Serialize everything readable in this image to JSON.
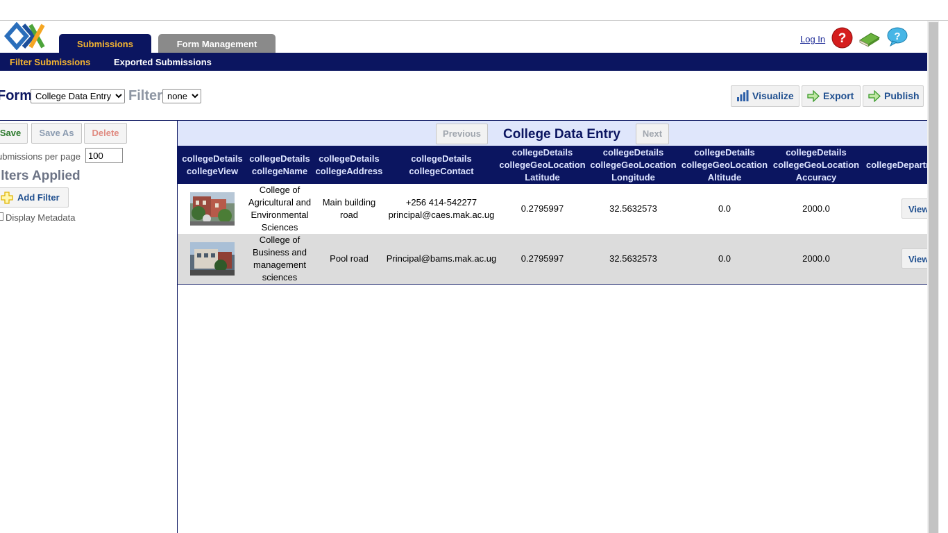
{
  "header": {
    "logo": "odk-logo",
    "tabs": [
      {
        "label": "Submissions",
        "active": true
      },
      {
        "label": "Form Management",
        "active": false
      }
    ],
    "login_label": "Log In",
    "icons": [
      "help-icon",
      "book-icon",
      "chat-help-icon"
    ]
  },
  "subnav": {
    "items": [
      "Filter Submissions",
      "Exported Submissions"
    ]
  },
  "formbar": {
    "form_label": "Form",
    "form_selected": "College Data Entry",
    "filter_label": "Filter",
    "filter_selected": "none",
    "actions": [
      "Visualize",
      "Export",
      "Publish"
    ]
  },
  "leftpanel": {
    "save_label": "Save",
    "saveas_label": "Save As",
    "delete_label": "Delete",
    "per_page_label": "ubmissions per page",
    "per_page_value": "100",
    "filters_applied": "ilters Applied",
    "add_filter_label": "Add Filter",
    "display_metadata_label": "Display Metadata"
  },
  "table": {
    "previous_label": "Previous",
    "title": "College Data Entry",
    "next_label": "Next",
    "columns": [
      {
        "l1": "collegeDetails",
        "l2": "collegeView",
        "l3": ""
      },
      {
        "l1": "collegeDetails",
        "l2": "collegeName",
        "l3": ""
      },
      {
        "l1": "collegeDetails",
        "l2": "collegeAddress",
        "l3": ""
      },
      {
        "l1": "collegeDetails",
        "l2": "collegeContact",
        "l3": ""
      },
      {
        "l1": "collegeDetails",
        "l2": "collegeGeoLocation",
        "l3": "Latitude"
      },
      {
        "l1": "collegeDetails",
        "l2": "collegeGeoLocation",
        "l3": "Longitude"
      },
      {
        "l1": "collegeDetails",
        "l2": "collegeGeoLocation",
        "l3": "Altitude"
      },
      {
        "l1": "collegeDetails",
        "l2": "collegeGeoLocation",
        "l3": "Accuracy"
      },
      {
        "l1": "collegeDepartr",
        "l2": "",
        "l3": ""
      }
    ],
    "rows": [
      {
        "name": [
          "College of",
          "Agricultural and",
          "Environmental",
          "Sciences"
        ],
        "address": [
          "Main building",
          "road"
        ],
        "contact": [
          "+256 414-542277",
          "principal@caes.mak.ac.ug"
        ],
        "latitude": "0.2795997",
        "longitude": "32.5632573",
        "altitude": "0.0",
        "accuracy": "2000.0",
        "view_label": "View"
      },
      {
        "name": [
          "College of",
          "Business and",
          "management",
          "sciences"
        ],
        "address": [
          "Pool road"
        ],
        "contact": [
          "Principal@bams.mak.ac.ug"
        ],
        "latitude": "0.2795997",
        "longitude": "32.5632573",
        "altitude": "0.0",
        "accuracy": "2000.0",
        "view_label": "View"
      }
    ]
  },
  "colors": {
    "navy": "#0b1560",
    "accent": "#f5b531",
    "pager_bg": "#dfe6fb",
    "alt_row": "#dcdcdc"
  }
}
